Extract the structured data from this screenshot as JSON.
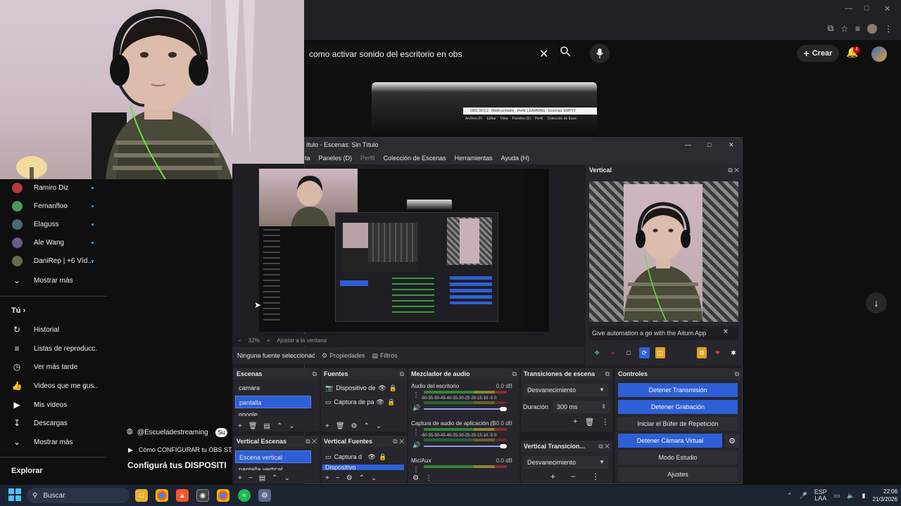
{
  "youtube": {
    "search_query": "como activar sonido del escritorio en obs",
    "create_label": "Crear",
    "notification_count": "4",
    "subscriptions": [
      {
        "name": "Ramiro Diz",
        "color": "#b53a3a"
      },
      {
        "name": "Fernanfloo",
        "color": "#4a9a5a"
      },
      {
        "name": "Elaguss",
        "color": "#4a6a7a"
      },
      {
        "name": "Ale Wang",
        "color": "#6a5a8a"
      },
      {
        "name": "DaniRep | +6 Víd...",
        "color": "#6a6a4a"
      }
    ],
    "show_more": "Mostrar más",
    "you_section": "Tú",
    "you_items": [
      "Historial",
      "Listas de reproducc...",
      "Ver más tarde",
      "Videos que me gus...",
      "Mis videos",
      "Descargas"
    ],
    "show_more_2": "Mostrar más",
    "explore": "Explorar",
    "channel_handle": "@Escueladestreaming",
    "playing_title": "Cómo CONFIGURAR tu OBS ST",
    "video_big_title": "Configurá tus DISPOSITI"
  },
  "obs": {
    "title": "ítulo - Escenas: Sin Título",
    "menu": [
      "ta",
      "Paneles (D)",
      "Perfil",
      "Colección de Escenas",
      "Herramientas",
      "Ayuda (H)"
    ],
    "zoom": "32%",
    "fit_label": "Ajustar a la ventana",
    "no_source": "Ninguna fuente seleccionad",
    "properties": "Propiedades",
    "filters": "Filtros",
    "vertical": {
      "title": "Vertical",
      "aitum_banner": "Give automation a go with the Aitum App"
    },
    "scenes": {
      "title": "Escenas",
      "items": [
        "camara",
        "pantalla",
        "google"
      ]
    },
    "sources": {
      "title": "Fuentes",
      "items": [
        "Dispositivo de vid",
        "Captura de pan"
      ]
    },
    "mixer": {
      "title": "Mezclador de audio",
      "channels": [
        {
          "name": "Audio del escritorio",
          "db": "0.0 dB"
        },
        {
          "name": "Captura de audio de aplicación (B",
          "db": "0.0 dB"
        },
        {
          "name": "Mic/Aux",
          "db": "0.0 dB"
        }
      ],
      "scale": "-60-55-50-45-40-35-30-25-20-15-10 -5 0"
    },
    "transitions": {
      "title": "Transiciones de escena",
      "selected": "Desvanecimiento",
      "duration_label": "Duración",
      "duration_value": "300 ms"
    },
    "controls": {
      "title": "Controles",
      "buttons": [
        "Detener Transmisión",
        "Detener Grabación",
        "Iniciar el Búfer de Repetición",
        "Detener Cámara Virtual",
        "Modo Estudio",
        "Ajustes"
      ]
    },
    "vertical_scenes": {
      "title": "Vertical Escenas",
      "items": [
        "Escena vertical",
        "pantalla vertical"
      ]
    },
    "vertical_sources": {
      "title": "Vertical Fuentes",
      "items": [
        "Captura d",
        "Dispositivo"
      ]
    },
    "vertical_transitions": {
      "title": "Vertical Transicion...",
      "selected": "Desvanecimiento"
    }
  },
  "mini_obs": {
    "title": "OBS 30.0.2 - Modo portable - Perfil: LEARNING - Escenas: EMPTY",
    "menu": [
      "Archivo (F)",
      "Editar",
      "Vista",
      "Paneles (D)",
      "Perfil",
      "Colección de Esce"
    ]
  },
  "taskbar": {
    "search_placeholder": "Buscar",
    "lang_1": "ESP",
    "lang_2": "LAA",
    "time": "22:06",
    "date": "21/3/2026"
  },
  "colors": {
    "obs_blue": "#2f5fd6",
    "yt_red": "#cc0000",
    "bg": "#0f0f0f"
  }
}
